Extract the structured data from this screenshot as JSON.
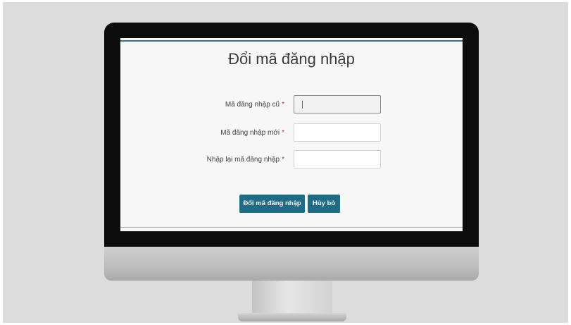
{
  "form": {
    "title": "Đổi mã đăng nhập",
    "fields": [
      {
        "label": "Mã đăng nhập cũ",
        "required_mark": "*",
        "value": ""
      },
      {
        "label": "Mã đăng nhập mới",
        "required_mark": "*",
        "value": ""
      },
      {
        "label": "Nhập lại mã đăng nhập",
        "required_mark": "*",
        "value": ""
      }
    ],
    "buttons": {
      "submit_label": "Đổi mã đăng nhập",
      "cancel_label": "Hủy bỏ"
    }
  },
  "colors": {
    "button_bg": "#226b86",
    "required_mark": "#c0392b",
    "monitor_bezel": "#0c0c0c",
    "background": "#dcdcdc"
  }
}
